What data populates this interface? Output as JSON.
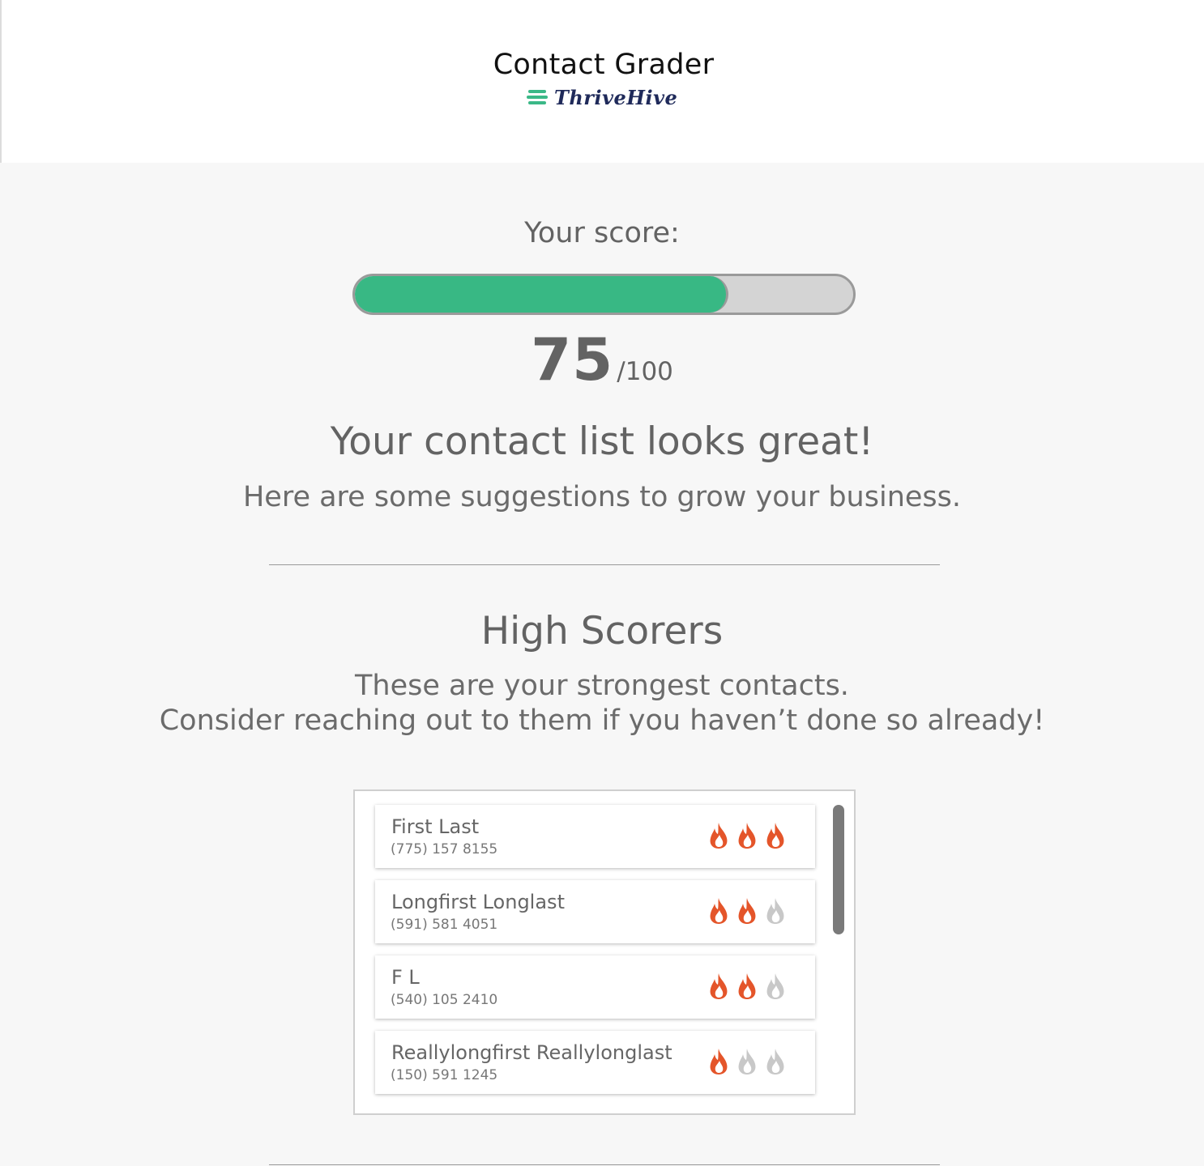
{
  "header": {
    "app_title": "Contact Grader",
    "brand_name": "ThriveHive",
    "brand_color": "#3bb887",
    "brand_text_color": "#1f2a5a"
  },
  "score": {
    "label": "Your score:",
    "value": "75",
    "max_label": "/100",
    "progress_percent": 75,
    "progress_color": "#38b884"
  },
  "summary": {
    "headline": "Your contact list looks great!",
    "subline": "Here are some suggestions to grow your business."
  },
  "high_scorers": {
    "title": "High Scorers",
    "description_line1": "These are your strongest contacts.",
    "description_line2": "Consider reaching out to them if you haven’t done so already!",
    "contacts": [
      {
        "name": "First Last",
        "phone": "(775) 157 8155",
        "flames_lit": 3,
        "flames_total": 3
      },
      {
        "name": "Longfirst Longlast",
        "phone": "(591) 581 4051",
        "flames_lit": 2,
        "flames_total": 3
      },
      {
        "name": "F L",
        "phone": "(540) 105 2410",
        "flames_lit": 2,
        "flames_total": 3
      },
      {
        "name": "Reallylongfirst Reallylonglast",
        "phone": "(150) 591 1245",
        "flames_lit": 1,
        "flames_total": 3
      }
    ],
    "flame_icon": "flame-icon",
    "flame_lit_color": "#e4552a",
    "flame_unlit_color": "#c8c8c8"
  }
}
